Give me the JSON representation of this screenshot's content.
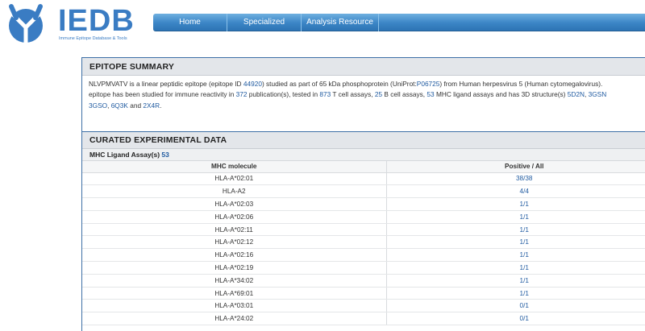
{
  "header": {
    "logo_title": "IEDB",
    "logo_subtitle": "Immune Epitope Database & Tools",
    "logo_icon": "iedb-antibody-logo-icon",
    "brand_color": "#3a7cc3"
  },
  "nav": {
    "home": "Home",
    "specialized_searches": "Specialized Searches",
    "analysis_resource": "Analysis Resource"
  },
  "summary": {
    "title": "EPITOPE SUMMARY",
    "t1": "NLVPMVATV is a linear peptidic epitope (epitope ID ",
    "epitope_id": "44920",
    "t2": ") studied as part of 65 kDa phosphoprotein (UniProt:",
    "uniprot": "P06725",
    "t3": ") from Human herpesvirus 5 (Human cytomegalovirus).",
    "t4": "epitope has been studied for immune reactivity in ",
    "publications": "372",
    "t5": " publication(s), tested in ",
    "tcell": "873",
    "t6": " T cell assays, ",
    "bcell": "25",
    "t7": " B cell assays, ",
    "mhc": "53",
    "t8": " MHC ligand assays and has 3D structure(s) ",
    "s1": "5D2N",
    "t9": ", ",
    "s2": "3GSN",
    "s3": "3GSO",
    "t10": ", ",
    "s4": "6Q3K",
    "t11": " and ",
    "s5": "2X4R",
    "t12": "."
  },
  "curated": {
    "title": "CURATED EXPERIMENTAL DATA",
    "mhc_label": "MHC Ligand Assay(s) ",
    "mhc_count": "53",
    "col_molecule": "MHC molecule",
    "col_positive": "Positive / All",
    "rows": [
      {
        "molecule": "HLA-A*02:01",
        "ratio": "38/38"
      },
      {
        "molecule": "HLA-A2",
        "ratio": "4/4"
      },
      {
        "molecule": "HLA-A*02:03",
        "ratio": "1/1"
      },
      {
        "molecule": "HLA-A*02:06",
        "ratio": "1/1"
      },
      {
        "molecule": "HLA-A*02:11",
        "ratio": "1/1"
      },
      {
        "molecule": "HLA-A*02:12",
        "ratio": "1/1"
      },
      {
        "molecule": "HLA-A*02:16",
        "ratio": "1/1"
      },
      {
        "molecule": "HLA-A*02:19",
        "ratio": "1/1"
      },
      {
        "molecule": "HLA-A*34:02",
        "ratio": "1/1"
      },
      {
        "molecule": "HLA-A*69:01",
        "ratio": "1/1"
      },
      {
        "molecule": "HLA-A*03:01",
        "ratio": "0/1"
      },
      {
        "molecule": "HLA-A*24:02",
        "ratio": "0/1"
      }
    ]
  }
}
